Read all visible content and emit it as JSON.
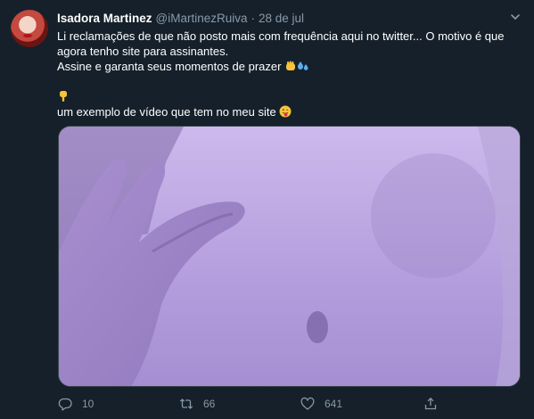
{
  "tweet": {
    "name": "Isadora Martinez",
    "handle": "@iMartinezRuiva",
    "separator": "·",
    "date": "28 de jul",
    "text_lines": [
      "Li reclamações de que não posto mais com frequência aqui no twitter... O motivo é que agora tenho site para assinantes.",
      "Assine e garanta seus momentos de prazer",
      "",
      "um exemplo de vídeo que tem no meu site"
    ],
    "emojis": [
      "raised-fist-emoji",
      "sweat-droplets-emoji",
      "pointing-down-emoji",
      "tongue-out-emoji"
    ],
    "media_description_icon": "video-thumbnail",
    "actions": {
      "reply_count": "10",
      "retweet_count": "66",
      "like_count": "641"
    }
  },
  "colors": {
    "background": "#15202b",
    "secondary_text": "#8899a6",
    "primary_text": "#ffffff",
    "border": "#38444d"
  }
}
